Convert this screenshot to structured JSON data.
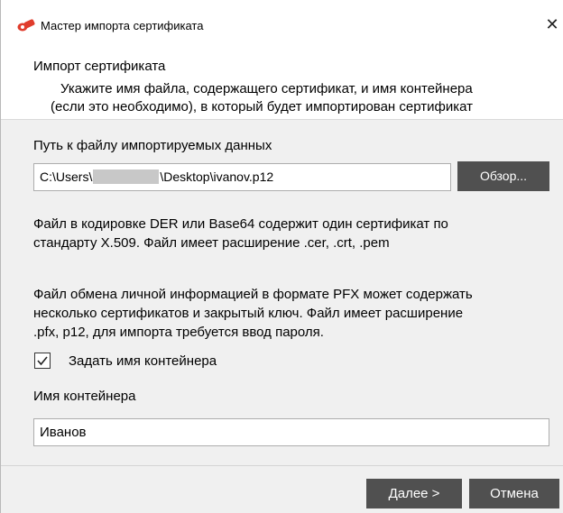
{
  "window": {
    "title": "Мастер импорта сертификата",
    "close_glyph": "✕",
    "icon": "certificate-wizard-icon"
  },
  "header": {
    "title": "Импорт сертификата",
    "desc_line1": "Укажите имя файла, содержащего сертификат, и имя контейнера",
    "desc_line2": "(если это необходимо), в который будет импортирован сертификат"
  },
  "file": {
    "label": "Путь к файлу импортируемых данных",
    "path_prefix": "C:\\Users\\",
    "path_suffix": "\\Desktop\\ivanov.p12",
    "browse_label": "Обзор..."
  },
  "info": {
    "der_line1": "Файл в кодировке DER или Base64 содержит один сертификат по",
    "der_line2": "стандарту X.509. Файл имеет расширение .cer, .crt, .pem",
    "pfx_line1": "Файл обмена личной информацией в формате PFX может содержать",
    "pfx_line2": "несколько сертификатов и закрытый ключ. Файл имеет расширение",
    "pfx_line3": ".pfx, p12, для импорта требуется ввод пароля."
  },
  "container": {
    "checkbox_label": "Задать имя контейнера",
    "checked": true,
    "name_label": "Имя контейнера",
    "name_value": "Иванов"
  },
  "footer": {
    "next_label": "Далее >",
    "cancel_label": "Отмена"
  },
  "colors": {
    "dialog_bg": "#f0f0f0",
    "button_bg": "#505050",
    "icon_red": "#e03c2c"
  }
}
